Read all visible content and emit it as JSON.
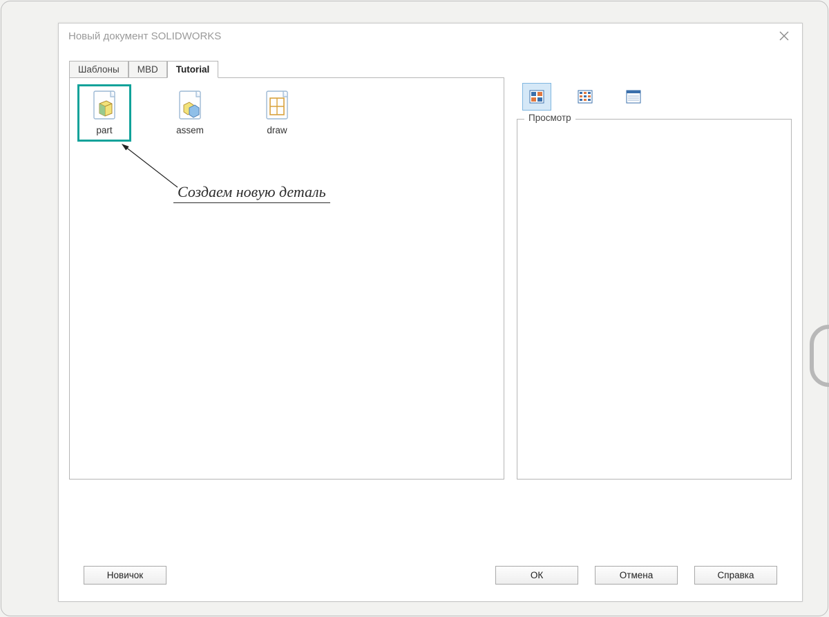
{
  "dialog": {
    "title": "Новый документ SOLIDWORKS"
  },
  "tabs": [
    {
      "label": "Шаблоны",
      "active": false
    },
    {
      "label": "MBD",
      "active": false
    },
    {
      "label": "Tutorial",
      "active": true
    }
  ],
  "templates": [
    {
      "id": "part",
      "label": "part",
      "highlighted": true
    },
    {
      "id": "assem",
      "label": "assem",
      "highlighted": false
    },
    {
      "id": "draw",
      "label": "draw",
      "highlighted": false
    }
  ],
  "annotation": {
    "text": "Создаем новую деталь"
  },
  "preview": {
    "legend": "Просмотр"
  },
  "view_buttons": {
    "selected_index": 0
  },
  "buttons": {
    "novice": "Новичок",
    "ok": "ОК",
    "cancel": "Отмена",
    "help": "Справка"
  },
  "colors": {
    "highlight": "#11a29a",
    "selected_view_bg": "#d5e8f7"
  }
}
